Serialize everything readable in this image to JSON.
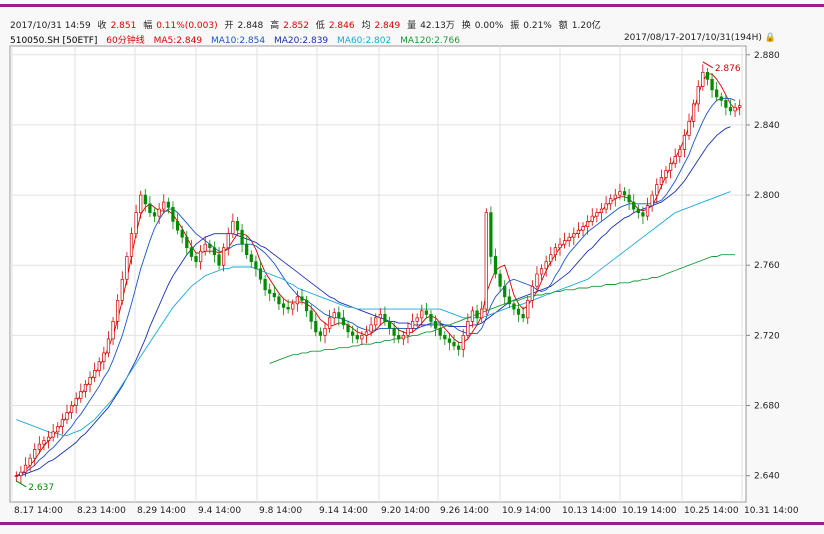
{
  "quote": {
    "datetime": "2017/10/31 14:59",
    "close_label": "收",
    "close": "2.851",
    "change_label": "幅",
    "change": "0.11%(0.003)",
    "open_label": "开",
    "open": "2.848",
    "high_label": "高",
    "high": "2.852",
    "low_label": "低",
    "low": "2.846",
    "avg_label": "均",
    "avg": "2.849",
    "volume_label": "量",
    "volume": "42.13万",
    "turnover_label": "换",
    "turnover": "0.00%",
    "amplitude_label": "振",
    "amplitude": "0.21%",
    "amount_label": "额",
    "amount": "1.20亿"
  },
  "indicators": {
    "symbol": "510050.SH [50ETF]",
    "period": "60分钟线",
    "ma5": "MA5:2.849",
    "ma10": "MA10:2.854",
    "ma20": "MA20:2.839",
    "ma60": "MA60:2.802",
    "ma120": "MA120:2.766",
    "range": "2017/08/17-2017/10/31(194H)"
  },
  "colors": {
    "up": "#d40000",
    "down": "#008a00",
    "ma5": "#d40000",
    "ma10": "#1a55c8",
    "ma20": "#1a2fb0",
    "ma60": "#1aa8d8",
    "ma120": "#1a9a3a",
    "accent_bar": "#9b1d8a"
  },
  "chart_data": {
    "type": "candlestick",
    "title": "",
    "xlabel": "",
    "ylabel": "",
    "ylim": [
      2.625,
      2.885
    ],
    "y_ticks": [
      "2.880",
      "2.840",
      "2.800",
      "2.760",
      "2.720",
      "2.680",
      "2.640"
    ],
    "x_ticks": [
      "8.17 14:00",
      "8.23 14:00",
      "8.29 14:00",
      "9.4 14:00",
      "9.8 14:00",
      "9.14 14:00",
      "9.20 14:00",
      "9.26 14:00",
      "10.9 14:00",
      "10.13 14:00",
      "10.19 14:00",
      "10.25 14:00",
      "10.31 14:00"
    ],
    "grid": true,
    "annotations": [
      {
        "label": "2.637",
        "value": 2.637,
        "at": "low"
      },
      {
        "label": "2.876",
        "value": 2.876,
        "at": "high"
      }
    ],
    "close": [
      2.64,
      2.642,
      2.646,
      2.65,
      2.655,
      2.658,
      2.66,
      2.662,
      2.665,
      2.668,
      2.672,
      2.676,
      2.68,
      2.684,
      2.688,
      2.692,
      2.696,
      2.7,
      2.705,
      2.71,
      2.718,
      2.728,
      2.74,
      2.752,
      2.765,
      2.778,
      2.79,
      2.8,
      2.795,
      2.79,
      2.788,
      2.792,
      2.796,
      2.793,
      2.785,
      2.78,
      2.776,
      2.77,
      2.765,
      2.762,
      2.768,
      2.772,
      2.77,
      2.766,
      2.76,
      2.77,
      2.778,
      2.785,
      2.78,
      2.772,
      2.766,
      2.762,
      2.758,
      2.752,
      2.746,
      2.744,
      2.742,
      2.738,
      2.736,
      2.735,
      2.738,
      2.742,
      2.74,
      2.734,
      2.728,
      2.722,
      2.72,
      2.724,
      2.73,
      2.733,
      2.73,
      2.726,
      2.722,
      2.72,
      2.718,
      2.72,
      2.722,
      2.726,
      2.73,
      2.732,
      2.728,
      2.724,
      2.72,
      2.718,
      2.72,
      2.724,
      2.728,
      2.73,
      2.734,
      2.732,
      2.728,
      2.724,
      2.72,
      2.718,
      2.716,
      2.714,
      2.712,
      2.72,
      2.728,
      2.734,
      2.73,
      2.735,
      2.79,
      2.765,
      2.755,
      2.748,
      2.742,
      2.738,
      2.735,
      2.732,
      2.73,
      2.74,
      2.748,
      2.755,
      2.758,
      2.762,
      2.766,
      2.77,
      2.772,
      2.774,
      2.776,
      2.778,
      2.78,
      2.782,
      2.785,
      2.788,
      2.79,
      2.792,
      2.795,
      2.798,
      2.8,
      2.802,
      2.8,
      2.796,
      2.792,
      2.79,
      2.788,
      2.794,
      2.8,
      2.806,
      2.81,
      2.814,
      2.818,
      2.822,
      2.826,
      2.834,
      2.842,
      2.852,
      2.862,
      2.87,
      2.866,
      2.86,
      2.856,
      2.854,
      2.85,
      2.848,
      2.85,
      2.851
    ],
    "series": [
      {
        "name": "MA5:2.849",
        "values": [
          2.64,
          2.641,
          2.643,
          2.646,
          2.649,
          2.653,
          2.657,
          2.66,
          2.663,
          2.666,
          2.67,
          2.674,
          2.678,
          2.682,
          2.686,
          2.69,
          2.694,
          2.698,
          2.702,
          2.707,
          2.713,
          2.72,
          2.729,
          2.74,
          2.752,
          2.765,
          2.778,
          2.789,
          2.793,
          2.795,
          2.793,
          2.791,
          2.791,
          2.791,
          2.789,
          2.785,
          2.781,
          2.776,
          2.771,
          2.767,
          2.767,
          2.768,
          2.768,
          2.768,
          2.767,
          2.768,
          2.77,
          2.774,
          2.778,
          2.778,
          2.777,
          2.774,
          2.769,
          2.762,
          2.756,
          2.752,
          2.748,
          2.744,
          2.741,
          2.739,
          2.739,
          2.739,
          2.739,
          2.738,
          2.736,
          2.733,
          2.729,
          2.727,
          2.725,
          2.726,
          2.727,
          2.727,
          2.726,
          2.724,
          2.722,
          2.721,
          2.72,
          2.721,
          2.723,
          2.726,
          2.728,
          2.728,
          2.726,
          2.723,
          2.722,
          2.721,
          2.722,
          2.724,
          2.727,
          2.73,
          2.731,
          2.73,
          2.727,
          2.724,
          2.721,
          2.718,
          2.716,
          2.716,
          2.718,
          2.722,
          2.726,
          2.731,
          2.744,
          2.751,
          2.757,
          2.759,
          2.76,
          2.752,
          2.743,
          2.738,
          2.735,
          2.737,
          2.741,
          2.745,
          2.751,
          2.757,
          2.762,
          2.766,
          2.77,
          2.773,
          2.775,
          2.777,
          2.779,
          2.781,
          2.784,
          2.786,
          2.789,
          2.791,
          2.794,
          2.796,
          2.798,
          2.799,
          2.799,
          2.798,
          2.795,
          2.792,
          2.791,
          2.792,
          2.794,
          2.799,
          2.805,
          2.811,
          2.816,
          2.821,
          2.826,
          2.832,
          2.839,
          2.848,
          2.857,
          2.865,
          2.869,
          2.869,
          2.866,
          2.862,
          2.857,
          2.852,
          2.849,
          2.849
        ]
      },
      {
        "name": "MA10:2.854",
        "values": [
          2.64,
          2.641,
          2.642,
          2.644,
          2.646,
          2.649,
          2.651,
          2.654,
          2.656,
          2.659,
          2.662,
          2.665,
          2.668,
          2.672,
          2.675,
          2.679,
          2.683,
          2.687,
          2.691,
          2.696,
          2.7,
          2.706,
          2.713,
          2.72,
          2.729,
          2.738,
          2.748,
          2.758,
          2.766,
          2.774,
          2.781,
          2.786,
          2.79,
          2.792,
          2.792,
          2.79,
          2.787,
          2.784,
          2.781,
          2.778,
          2.776,
          2.774,
          2.772,
          2.77,
          2.768,
          2.768,
          2.769,
          2.771,
          2.772,
          2.772,
          2.772,
          2.772,
          2.771,
          2.769,
          2.767,
          2.764,
          2.761,
          2.757,
          2.753,
          2.749,
          2.746,
          2.743,
          2.741,
          2.74,
          2.738,
          2.736,
          2.734,
          2.732,
          2.731,
          2.73,
          2.73,
          2.729,
          2.728,
          2.727,
          2.725,
          2.724,
          2.723,
          2.723,
          2.723,
          2.724,
          2.724,
          2.724,
          2.724,
          2.724,
          2.724,
          2.724,
          2.724,
          2.724,
          2.725,
          2.726,
          2.727,
          2.727,
          2.727,
          2.726,
          2.726,
          2.725,
          2.723,
          2.722,
          2.721,
          2.721,
          2.721,
          2.724,
          2.73,
          2.737,
          2.742,
          2.745,
          2.748,
          2.751,
          2.752,
          2.751,
          2.75,
          2.749,
          2.748,
          2.746,
          2.745,
          2.746,
          2.749,
          2.754,
          2.758,
          2.763,
          2.767,
          2.77,
          2.773,
          2.776,
          2.779,
          2.781,
          2.783,
          2.785,
          2.787,
          2.789,
          2.791,
          2.793,
          2.794,
          2.795,
          2.795,
          2.795,
          2.795,
          2.795,
          2.795,
          2.796,
          2.797,
          2.8,
          2.804,
          2.808,
          2.813,
          2.818,
          2.823,
          2.83,
          2.836,
          2.842,
          2.847,
          2.851,
          2.854,
          2.855,
          2.855,
          2.855,
          2.854
        ]
      },
      {
        "name": "MA20:2.839",
        "values": [
          2.64,
          2.64,
          2.641,
          2.642,
          2.643,
          2.644,
          2.646,
          2.648,
          2.649,
          2.651,
          2.653,
          2.655,
          2.657,
          2.659,
          2.662,
          2.664,
          2.667,
          2.67,
          2.673,
          2.676,
          2.679,
          2.683,
          2.687,
          2.691,
          2.696,
          2.701,
          2.706,
          2.712,
          2.718,
          2.725,
          2.731,
          2.737,
          2.743,
          2.749,
          2.754,
          2.758,
          2.762,
          2.766,
          2.769,
          2.772,
          2.774,
          2.776,
          2.777,
          2.778,
          2.778,
          2.778,
          2.778,
          2.778,
          2.777,
          2.776,
          2.775,
          2.774,
          2.773,
          2.771,
          2.77,
          2.768,
          2.766,
          2.764,
          2.762,
          2.76,
          2.758,
          2.756,
          2.754,
          2.752,
          2.75,
          2.748,
          2.746,
          2.744,
          2.742,
          2.741,
          2.739,
          2.738,
          2.737,
          2.736,
          2.735,
          2.734,
          2.733,
          2.732,
          2.731,
          2.73,
          2.729,
          2.728,
          2.728,
          2.727,
          2.727,
          2.727,
          2.726,
          2.726,
          2.726,
          2.726,
          2.726,
          2.726,
          2.726,
          2.726,
          2.725,
          2.725,
          2.725,
          2.725,
          2.725,
          2.726,
          2.726,
          2.727,
          2.729,
          2.731,
          2.733,
          2.735,
          2.737,
          2.739,
          2.74,
          2.741,
          2.742,
          2.743,
          2.744,
          2.745,
          2.746,
          2.747,
          2.748,
          2.75,
          2.752,
          2.754,
          2.756,
          2.759,
          2.762,
          2.765,
          2.768,
          2.77,
          2.773,
          2.776,
          2.778,
          2.781,
          2.783,
          2.785,
          2.787,
          2.788,
          2.79,
          2.791,
          2.792,
          2.793,
          2.794,
          2.795,
          2.796,
          2.798,
          2.8,
          2.802,
          2.805,
          2.808,
          2.812,
          2.816,
          2.82,
          2.824,
          2.828,
          2.831,
          2.834,
          2.836,
          2.838,
          2.839
        ]
      },
      {
        "name": "MA60:2.802",
        "values": [
          2.672,
          2.671,
          2.67,
          2.669,
          2.668,
          2.667,
          2.666,
          2.665,
          2.664,
          2.664,
          2.663,
          2.663,
          2.664,
          2.665,
          2.666,
          2.668,
          2.67,
          2.672,
          2.675,
          2.678,
          2.681,
          2.684,
          2.688,
          2.692,
          2.696,
          2.7,
          2.704,
          2.708,
          2.712,
          2.716,
          2.72,
          2.724,
          2.728,
          2.732,
          2.736,
          2.739,
          2.742,
          2.745,
          2.748,
          2.75,
          2.752,
          2.754,
          2.755,
          2.756,
          2.757,
          2.758,
          2.758,
          2.759,
          2.759,
          2.759,
          2.759,
          2.759,
          2.758,
          2.757,
          2.756,
          2.755,
          2.754,
          2.753,
          2.752,
          2.75,
          2.749,
          2.747,
          2.746,
          2.745,
          2.744,
          2.743,
          2.742,
          2.741,
          2.74,
          2.739,
          2.738,
          2.737,
          2.736,
          2.736,
          2.735,
          2.735,
          2.735,
          2.735,
          2.735,
          2.735,
          2.735,
          2.735,
          2.735,
          2.735,
          2.735,
          2.735,
          2.735,
          2.735,
          2.735,
          2.735,
          2.735,
          2.735,
          2.735,
          2.734,
          2.733,
          2.732,
          2.731,
          2.73,
          2.73,
          2.73,
          2.73,
          2.73,
          2.731,
          2.732,
          2.733,
          2.734,
          2.735,
          2.736,
          2.737,
          2.737,
          2.738,
          2.739,
          2.74,
          2.741,
          2.742,
          2.743,
          2.744,
          2.745,
          2.746,
          2.747,
          2.748,
          2.749,
          2.75,
          2.751,
          2.752,
          2.754,
          2.756,
          2.758,
          2.76,
          2.762,
          2.764,
          2.766,
          2.768,
          2.77,
          2.772,
          2.774,
          2.776,
          2.778,
          2.78,
          2.782,
          2.784,
          2.786,
          2.788,
          2.79,
          2.791,
          2.792,
          2.793,
          2.794,
          2.795,
          2.796,
          2.797,
          2.798,
          2.799,
          2.8,
          2.801,
          2.802
        ]
      },
      {
        "name": "MA120:2.766",
        "values": [
          null,
          null,
          null,
          null,
          null,
          null,
          null,
          null,
          null,
          null,
          null,
          null,
          null,
          null,
          null,
          null,
          null,
          null,
          null,
          null,
          null,
          null,
          null,
          null,
          null,
          null,
          null,
          null,
          null,
          null,
          null,
          null,
          null,
          null,
          null,
          null,
          null,
          null,
          null,
          null,
          null,
          null,
          null,
          null,
          null,
          null,
          null,
          null,
          null,
          null,
          null,
          null,
          null,
          null,
          null,
          2.704,
          2.705,
          2.706,
          2.707,
          2.708,
          2.709,
          2.709,
          2.71,
          2.71,
          2.711,
          2.711,
          2.711,
          2.712,
          2.712,
          2.712,
          2.713,
          2.713,
          2.713,
          2.714,
          2.714,
          2.715,
          2.715,
          2.715,
          2.716,
          2.716,
          2.717,
          2.717,
          2.718,
          2.718,
          2.719,
          2.719,
          2.72,
          2.72,
          2.721,
          2.722,
          2.722,
          2.723,
          2.724,
          2.725,
          2.726,
          2.727,
          2.728,
          2.729,
          2.73,
          2.731,
          2.732,
          2.733,
          2.734,
          2.735,
          2.736,
          2.737,
          2.738,
          2.739,
          2.74,
          2.74,
          2.741,
          2.742,
          2.742,
          2.743,
          2.743,
          2.744,
          2.744,
          2.745,
          2.745,
          2.746,
          2.746,
          2.746,
          2.747,
          2.747,
          2.747,
          2.748,
          2.748,
          2.748,
          2.749,
          2.749,
          2.749,
          2.75,
          2.75,
          2.75,
          2.751,
          2.751,
          2.752,
          2.752,
          2.753,
          2.753,
          2.754,
          2.755,
          2.756,
          2.757,
          2.758,
          2.759,
          2.76,
          2.761,
          2.762,
          2.763,
          2.764,
          2.765,
          2.765,
          2.766,
          2.766,
          2.766,
          2.766
        ]
      }
    ]
  }
}
